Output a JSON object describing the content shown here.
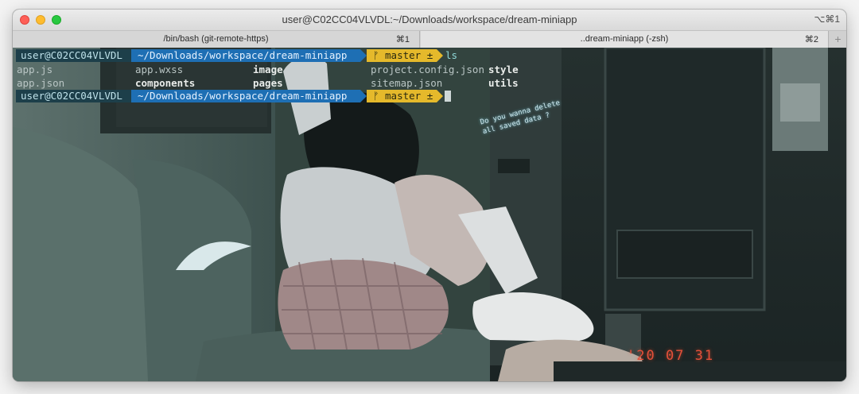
{
  "window": {
    "title": "user@C02CC04VLVDL:~/Downloads/workspace/dream-miniapp",
    "shortcut": "⌥⌘1"
  },
  "tabs": [
    {
      "label": "/bin/bash (git-remote-https)",
      "shortcut": "⌘1"
    },
    {
      "label": "..dream-miniapp (-zsh)",
      "shortcut": "⌘2"
    }
  ],
  "tab_add": "+",
  "terminal": {
    "prompt": {
      "user": "user@C02CC04VLVDL",
      "path": "~/Downloads/workspace/dream-miniapp",
      "git": "master ±"
    },
    "command": "ls",
    "ls_output": [
      [
        {
          "name": "app.js",
          "dir": false
        },
        {
          "name": "app.wxss",
          "dir": false
        },
        {
          "name": "image",
          "dir": true
        },
        {
          "name": "project.config.json",
          "dir": false
        },
        {
          "name": "style",
          "dir": true
        }
      ],
      [
        {
          "name": "app.json",
          "dir": false
        },
        {
          "name": "components",
          "dir": true
        },
        {
          "name": "pages",
          "dir": true
        },
        {
          "name": "sitemap.json",
          "dir": false
        },
        {
          "name": "utils",
          "dir": true
        }
      ]
    ]
  },
  "background": {
    "overlay_line1": "Do you wanna delete",
    "overlay_line2": "all saved data ?",
    "stamp": "'20 07 31"
  },
  "colors": {
    "prompt_user_bg": "#1d3f4a",
    "prompt_path_bg": "#1e6fb4",
    "prompt_git_bg": "#e5b92b"
  }
}
